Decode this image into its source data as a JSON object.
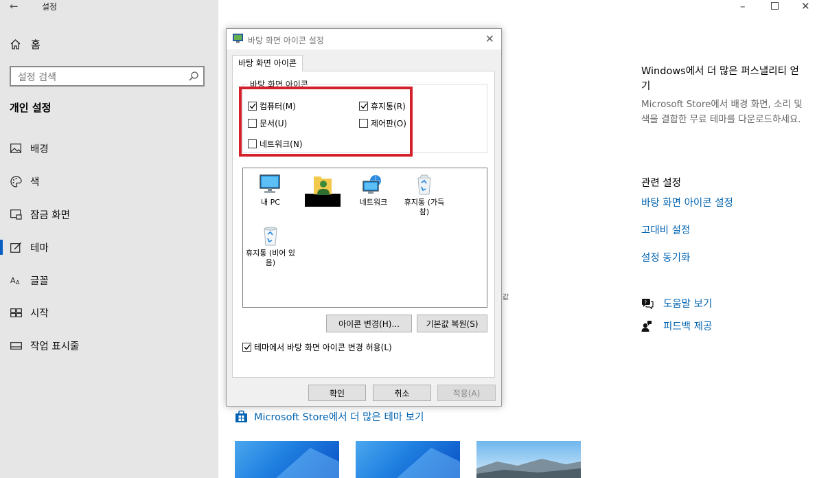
{
  "app": {
    "title": "설정"
  },
  "sidebar": {
    "home_label": "홈",
    "search_placeholder": "설정 검색",
    "group_title": "개인 설정",
    "items": [
      {
        "label": "배경",
        "icon": "picture-icon"
      },
      {
        "label": "색",
        "icon": "palette-icon"
      },
      {
        "label": "잠금 화면",
        "icon": "lock-screen-icon"
      },
      {
        "label": "테마",
        "icon": "theme-icon",
        "selected": true
      },
      {
        "label": "글꼴",
        "icon": "font-icon"
      },
      {
        "label": "시작",
        "icon": "start-icon"
      },
      {
        "label": "작업 표시줄",
        "icon": "taskbar-icon"
      }
    ]
  },
  "right": {
    "heading": "Windows에서 더 많은 퍼스낼리티 얻기",
    "description": "Microsoft Store에서 배경 화면, 소리 및 색을 결합한 무료 테마를 다운로드하세요.",
    "related_title": "관련 설정",
    "links": [
      "바탕 화면 아이콘 설정",
      "고대비 설정",
      "설정 동기화"
    ],
    "help": {
      "help_label": "도움말 보기",
      "feedback_label": "피드백 제공"
    }
  },
  "main": {
    "store_link": "Microsoft Store에서 더 많은 테마 보기",
    "obscured_text": "값"
  },
  "dialog": {
    "title": "바탕 화면 아이콘 설정",
    "tab_label": "바탕 화면 아이콘",
    "group_label": "바탕 화면 아이콘",
    "checkboxes": {
      "computer": {
        "label": "컴퓨터(M)",
        "checked": true
      },
      "recycle": {
        "label": "휴지통(R)",
        "checked": true
      },
      "documents": {
        "label": "문서(U)",
        "checked": false
      },
      "control_panel": {
        "label": "제어판(O)",
        "checked": false
      },
      "network": {
        "label": "네트워크(N)",
        "checked": false
      }
    },
    "icons": [
      {
        "label": "내 PC",
        "icon": "computer-icon"
      },
      {
        "label": "",
        "icon": "user-folder-icon",
        "redacted": true
      },
      {
        "label": "네트워크",
        "icon": "network-icon"
      },
      {
        "label": "휴지통 (가득 참)",
        "icon": "recycle-bin-full-icon"
      },
      {
        "label": "휴지통 (비어 있음)",
        "icon": "recycle-bin-empty-icon"
      }
    ],
    "change_icon_button": "아이콘 변경(H)...",
    "restore_default_button": "기본값 복원(S)",
    "allow_theme_checkbox": {
      "label": "테마에서 바탕 화면 아이콘 변경 허용(L)",
      "checked": true
    },
    "ok_button": "확인",
    "cancel_button": "취소",
    "apply_button": "적용(A)"
  },
  "colors": {
    "accent": "#0063b1",
    "sidebar_bg": "#e6e6e6",
    "highlight_box": "#d3202a"
  }
}
